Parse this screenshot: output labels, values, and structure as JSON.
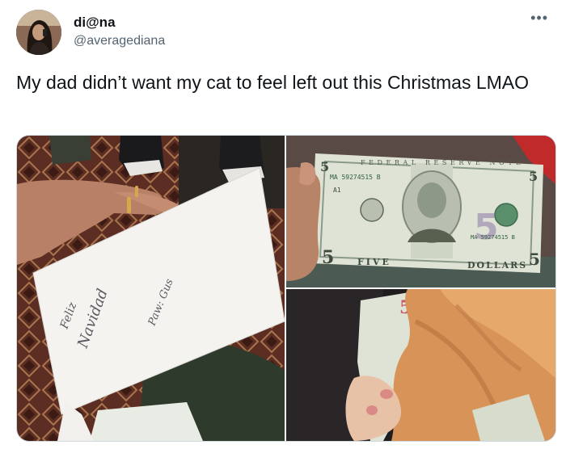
{
  "author": {
    "display_name": "di@na",
    "handle": "@averagediana"
  },
  "tweet": {
    "text": "My dad didn’t want my cat to feel left out this Christmas LMAO"
  },
  "more_icon": "•••",
  "photos": {
    "envelope": {
      "line1": "Feliz",
      "line2": "Navidad",
      "recipient": "Paw: Gus"
    },
    "bill": {
      "top_text": "FEDERAL RESERVE NOTE",
      "serial": "MA 59274515 B",
      "serial_right": "MA 59274515 B",
      "block": "A1",
      "corner": "5",
      "bottom_left": "FIVE",
      "bottom_right": "DOLLARS"
    },
    "cat_bill": {
      "corner": "5"
    }
  },
  "colors": {
    "text": "#0f1419",
    "secondary": "#536471",
    "border": "#cfd9de"
  }
}
